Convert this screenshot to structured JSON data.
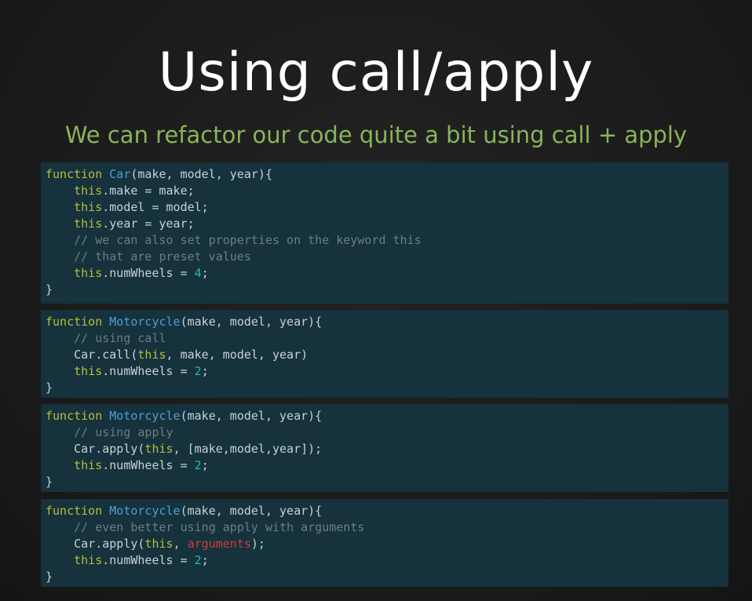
{
  "slide": {
    "title": "Using call/apply",
    "subtitle": "We can refactor our code quite a bit using call + apply"
  },
  "code_blocks": [
    {
      "lines": [
        [
          {
            "t": "function",
            "c": "kw"
          },
          {
            "t": " "
          },
          {
            "t": "Car",
            "c": "fn"
          },
          {
            "t": "(make, model, year){"
          }
        ],
        [
          {
            "t": "    "
          },
          {
            "t": "this",
            "c": "th"
          },
          {
            "t": ".make = make;"
          }
        ],
        [
          {
            "t": "    "
          },
          {
            "t": "this",
            "c": "th"
          },
          {
            "t": ".model = model;"
          }
        ],
        [
          {
            "t": "    "
          },
          {
            "t": "this",
            "c": "th"
          },
          {
            "t": ".year = year;"
          }
        ],
        [
          {
            "t": "    "
          },
          {
            "t": "// we can also set properties on the keyword this",
            "c": "cm"
          }
        ],
        [
          {
            "t": "    "
          },
          {
            "t": "// that are preset values",
            "c": "cm"
          }
        ],
        [
          {
            "t": "    "
          },
          {
            "t": "this",
            "c": "th"
          },
          {
            "t": ".numWheels = "
          },
          {
            "t": "4",
            "c": "num"
          },
          {
            "t": ";"
          }
        ],
        [
          {
            "t": "}"
          }
        ]
      ]
    },
    {
      "lines": [
        [
          {
            "t": "function",
            "c": "kw"
          },
          {
            "t": " "
          },
          {
            "t": "Motorcycle",
            "c": "fn"
          },
          {
            "t": "(make, model, year){"
          }
        ],
        [
          {
            "t": "    "
          },
          {
            "t": "// using call",
            "c": "cm"
          }
        ],
        [
          {
            "t": "    Car.call("
          },
          {
            "t": "this",
            "c": "th"
          },
          {
            "t": ", make, model, year)"
          }
        ],
        [
          {
            "t": "    "
          },
          {
            "t": "this",
            "c": "th"
          },
          {
            "t": ".numWheels = "
          },
          {
            "t": "2",
            "c": "num"
          },
          {
            "t": ";"
          }
        ],
        [
          {
            "t": "}"
          }
        ]
      ]
    },
    {
      "lines": [
        [
          {
            "t": "function",
            "c": "kw"
          },
          {
            "t": " "
          },
          {
            "t": "Motorcycle",
            "c": "fn"
          },
          {
            "t": "(make, model, year){"
          }
        ],
        [
          {
            "t": "    "
          },
          {
            "t": "// using apply",
            "c": "cm"
          }
        ],
        [
          {
            "t": "    Car.apply("
          },
          {
            "t": "this",
            "c": "th"
          },
          {
            "t": ", [make,model,year]);"
          }
        ],
        [
          {
            "t": "    "
          },
          {
            "t": "this",
            "c": "th"
          },
          {
            "t": ".numWheels = "
          },
          {
            "t": "2",
            "c": "num"
          },
          {
            "t": ";"
          }
        ],
        [
          {
            "t": "}"
          }
        ]
      ]
    },
    {
      "lines": [
        [
          {
            "t": "function",
            "c": "kw"
          },
          {
            "t": " "
          },
          {
            "t": "Motorcycle",
            "c": "fn"
          },
          {
            "t": "(make, model, year){"
          }
        ],
        [
          {
            "t": "    "
          },
          {
            "t": "// even better using apply with arguments",
            "c": "cm"
          }
        ],
        [
          {
            "t": "    Car.apply("
          },
          {
            "t": "this",
            "c": "th"
          },
          {
            "t": ", "
          },
          {
            "t": "arguments",
            "c": "arg"
          },
          {
            "t": ");"
          }
        ],
        [
          {
            "t": "    "
          },
          {
            "t": "this",
            "c": "th"
          },
          {
            "t": ".numWheels = "
          },
          {
            "t": "2",
            "c": "num"
          },
          {
            "t": ";"
          }
        ],
        [
          {
            "t": "}"
          }
        ]
      ]
    }
  ],
  "colors": {
    "background": "#1c1c1c",
    "title": "#ffffff",
    "subtitle": "#87b558",
    "code_background": "#15323d",
    "code_text": "#c8d2d6",
    "keyword": "#b8bd39",
    "function_name": "#4f9edb",
    "comment": "#6d7d84",
    "number": "#2bb8a6",
    "arguments": "#d23b3b"
  }
}
